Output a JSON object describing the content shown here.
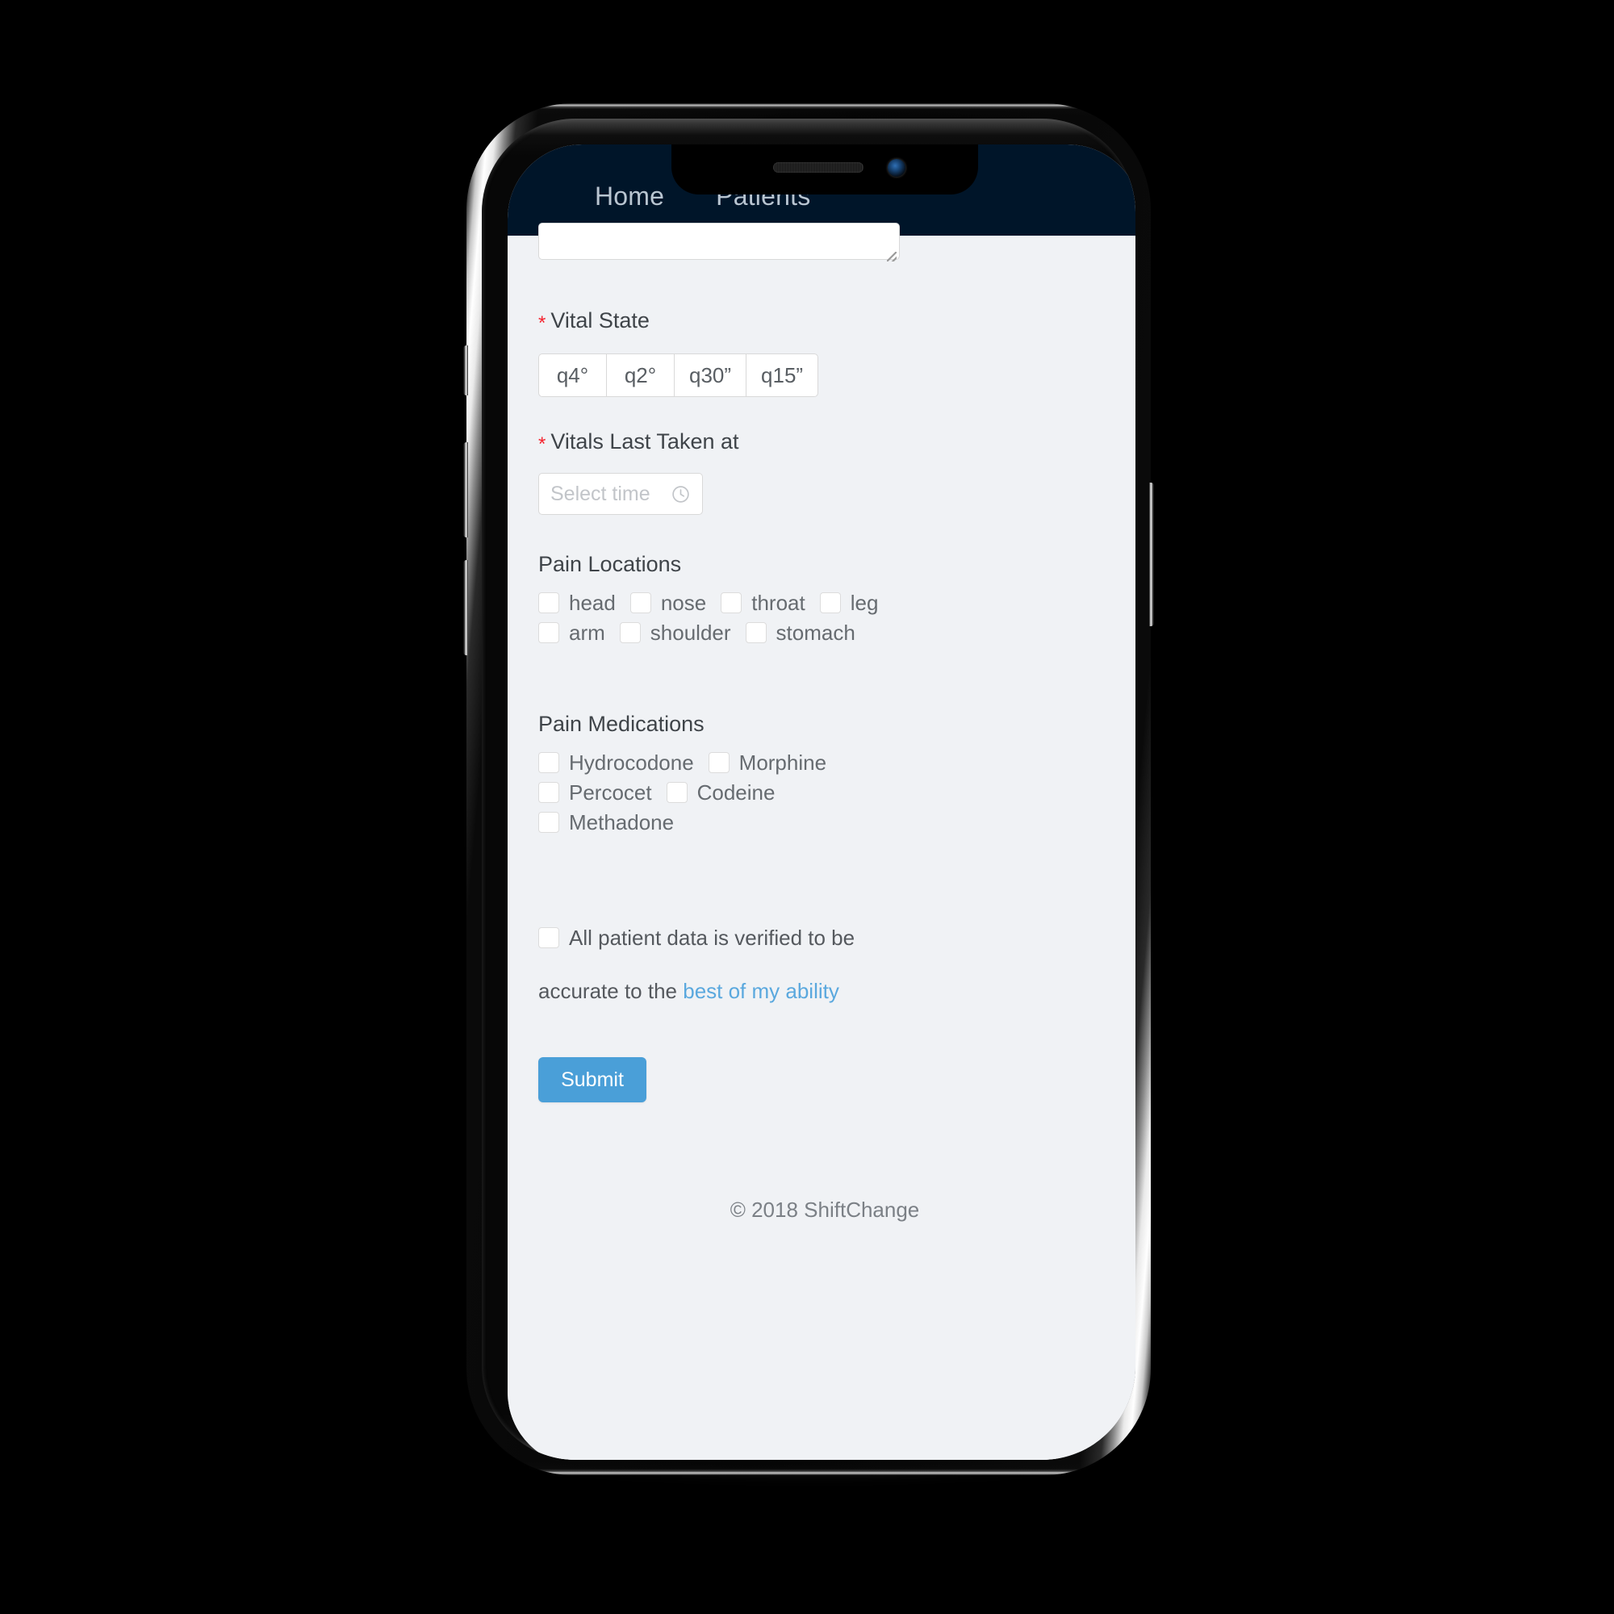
{
  "nav": {
    "items": [
      {
        "label": "Home",
        "name": "nav-item-home"
      },
      {
        "label": "Patients",
        "name": "nav-item-patients"
      },
      {
        "label": "···",
        "name": "nav-item-more"
      }
    ],
    "background_color": "#001529",
    "text_color": "#b9c5d1"
  },
  "form": {
    "notes_textarea": {
      "value": "",
      "placeholder": ""
    },
    "vital_state": {
      "label": "Vital State",
      "required_marker": "*",
      "required": true,
      "options": [
        "q4°",
        "q2°",
        "q30”",
        "q15”"
      ],
      "selected": null
    },
    "vitals_last_taken": {
      "label": "Vitals Last Taken at",
      "required_marker": "*",
      "required": true,
      "placeholder": "Select time",
      "value": "",
      "icon": "clock-icon"
    },
    "pain_locations": {
      "title": "Pain Locations",
      "options": [
        {
          "label": "head",
          "checked": false
        },
        {
          "label": "nose",
          "checked": false
        },
        {
          "label": "throat",
          "checked": false
        },
        {
          "label": "leg",
          "checked": false
        },
        {
          "label": "arm",
          "checked": false
        },
        {
          "label": "shoulder",
          "checked": false
        },
        {
          "label": "stomach",
          "checked": false
        }
      ]
    },
    "pain_medications": {
      "title": "Pain Medications",
      "options": [
        {
          "label": "Hydrocodone",
          "checked": false
        },
        {
          "label": "Morphine",
          "checked": false
        },
        {
          "label": "Percocet",
          "checked": false
        },
        {
          "label": "Codeine",
          "checked": false
        },
        {
          "label": "Methadone",
          "checked": false
        }
      ]
    },
    "verification": {
      "text_line1": "All patient data is verified to be",
      "text_line2_prefix": "accurate to the ",
      "link_text": "best of my ability",
      "checked": false,
      "link_color": "#5aa8de"
    },
    "submit": {
      "label": "Submit",
      "color": "#4a9fd8"
    }
  },
  "footer": {
    "copyright": "© 2018 ShiftChange"
  },
  "theme": {
    "screen_background": "#f0f2f5",
    "required_star_color": "#f5222d",
    "border_color": "#d9d9d9",
    "label_color": "#3f4449"
  }
}
